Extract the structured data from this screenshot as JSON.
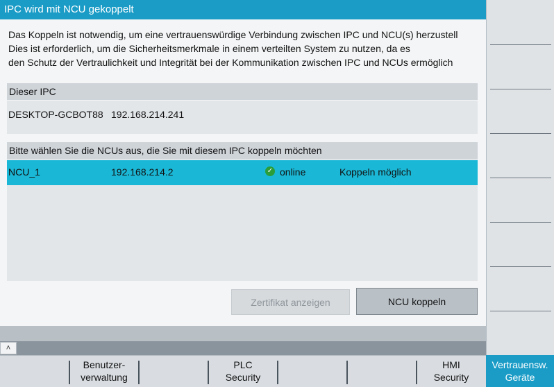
{
  "dialog": {
    "title": "IPC wird mit NCU gekoppelt",
    "intro_lines": [
      "Das Koppeln ist notwendig, um eine vertrauenswürdige Verbindung zwischen IPC und NCU(s) herzustell",
      "Dies ist erforderlich, um die Sicherheitsmerkmale in einem verteilten System zu nutzen, da es",
      "den Schutz der Vertraulichkeit und Integrität bei der Kommunikation zwischen IPC und NCUs ermöglich"
    ]
  },
  "ipc_section": {
    "header": "Dieser IPC",
    "name": "DESKTOP-GCBOT88",
    "ip": "192.168.214.241"
  },
  "ncu_section": {
    "header": "Bitte wählen Sie die NCUs aus, die Sie mit diesem IPC koppeln möchten",
    "rows": [
      {
        "name": "NCU_1",
        "ip": "192.168.214.2",
        "status": "online",
        "action": "Koppeln möglich"
      }
    ]
  },
  "buttons": {
    "show_certificate": "Zertifikat anzeigen",
    "couple_ncu": "NCU koppeln"
  },
  "horizontal_softkeys": [
    {
      "line1": "",
      "line2": ""
    },
    {
      "line1": "Benutzer-",
      "line2": "verwaltung"
    },
    {
      "line1": "",
      "line2": ""
    },
    {
      "line1": "PLC",
      "line2": "Security"
    },
    {
      "line1": "",
      "line2": ""
    },
    {
      "line1": "",
      "line2": ""
    },
    {
      "line1": "HMI",
      "line2": "Security"
    }
  ],
  "active_softkey": {
    "line1": "Vertrauensw.",
    "line2": "Geräte"
  },
  "colors": {
    "accent": "#1a9cc7",
    "selected_row": "#1ab8d6",
    "online_status": "#2b9e3a"
  }
}
